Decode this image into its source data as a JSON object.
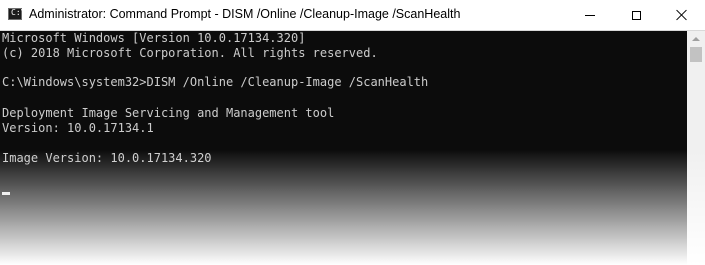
{
  "window": {
    "title": "Administrator: Command Prompt - DISM  /Online /Cleanup-Image /ScanHealth",
    "icon_text": "C:\\"
  },
  "console": {
    "lines": [
      "Microsoft Windows [Version 10.0.17134.320]",
      "(c) 2018 Microsoft Corporation. All rights reserved.",
      "",
      "C:\\Windows\\system32>DISM /Online /Cleanup-Image /ScanHealth",
      "",
      "Deployment Image Servicing and Management tool",
      "Version: 10.0.17134.1",
      "",
      "Image Version: 10.0.17134.320"
    ]
  },
  "colors": {
    "console_background": "#0c0c0c",
    "console_text": "#cccccc",
    "titlebar_background": "#ffffff"
  },
  "icons": {
    "app": "command-prompt-icon",
    "minimize": "minimize-icon",
    "maximize": "maximize-icon",
    "close": "close-icon",
    "scroll_up": "scroll-up-arrow-icon"
  }
}
